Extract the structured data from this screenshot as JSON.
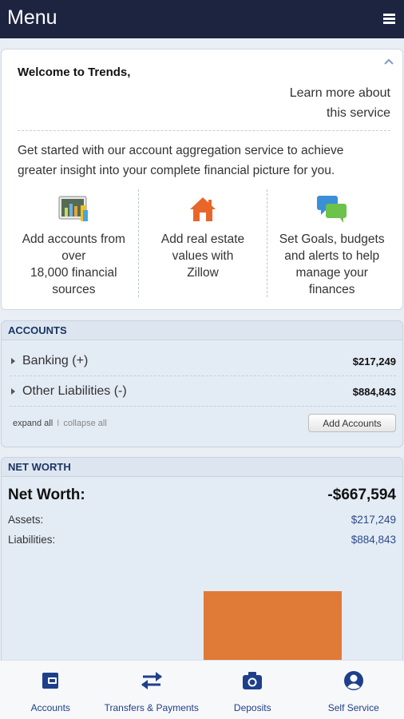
{
  "header": {
    "title": "Menu",
    "menu_icon": "hamburger-icon"
  },
  "welcome": {
    "heading": "Welcome to Trends,",
    "learn_more_line1": "Learn more about",
    "learn_more_line2": "this service",
    "intro": "Get started with our account aggregation service to achieve greater insight into your complete financial picture for you.",
    "features": [
      {
        "icon": "chart-icon",
        "lines": [
          "Add accounts from",
          "over",
          "18,000 financial",
          "sources"
        ]
      },
      {
        "icon": "house-icon",
        "lines": [
          "Add real estate",
          "values with",
          "Zillow"
        ]
      },
      {
        "icon": "chat-bubbles-icon",
        "lines": [
          "Set Goals, budgets",
          "and alerts to help",
          "manage your",
          "finances"
        ]
      }
    ]
  },
  "accounts": {
    "title": "ACCOUNTS",
    "rows": [
      {
        "name": "Banking (+)",
        "amount": "$217,249"
      },
      {
        "name": "Other Liabilities (-)",
        "amount": "$884,843"
      }
    ],
    "expand_all": "expand all",
    "separator": "I",
    "collapse_all": "collapse all",
    "add_button": "Add Accounts"
  },
  "net_worth": {
    "title": "NET WORTH",
    "label": "Net Worth:",
    "value": "-$667,594",
    "assets_label": "Assets:",
    "assets_value": "$217,249",
    "liabilities_label": "Liabilities:",
    "liabilities_value": "$884,843",
    "bar_color": "#e07a37"
  },
  "tabs": [
    {
      "label": "Accounts",
      "icon": "wallet-icon"
    },
    {
      "label": "Transfers & Payments",
      "icon": "transfer-arrows-icon"
    },
    {
      "label": "Deposits",
      "icon": "camera-icon"
    },
    {
      "label": "Self Service",
      "icon": "user-circle-icon"
    }
  ],
  "colors": {
    "header_bg": "#1c2440",
    "accent": "#1e3f8a",
    "panel_bg": "#e3ebf4"
  }
}
